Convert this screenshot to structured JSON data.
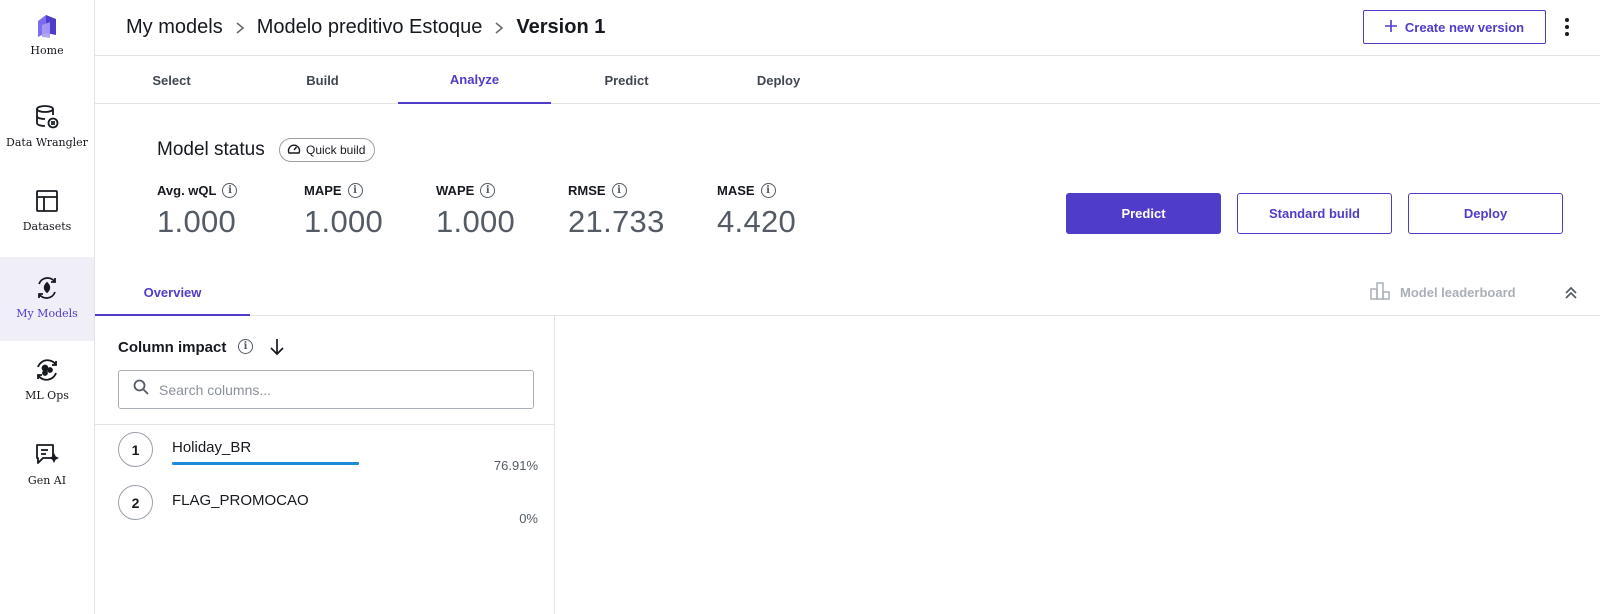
{
  "sidebar": {
    "items": [
      {
        "label": "Home",
        "icon": "canvas-logo-icon"
      },
      {
        "label": "Data Wrangler",
        "icon": "database-icon"
      },
      {
        "label": "Datasets",
        "icon": "table-icon"
      },
      {
        "label": "My Models",
        "icon": "models-icon",
        "active": true
      },
      {
        "label": "ML Ops",
        "icon": "mlops-icon"
      },
      {
        "label": "Gen AI",
        "icon": "chat-sparkle-icon"
      }
    ]
  },
  "header": {
    "breadcrumb": [
      "My models",
      "Modelo preditivo Estoque",
      "Version 1"
    ],
    "create_version_label": "Create new version"
  },
  "tabs": [
    {
      "label": "Select"
    },
    {
      "label": "Build"
    },
    {
      "label": "Analyze",
      "active": true
    },
    {
      "label": "Predict"
    },
    {
      "label": "Deploy"
    }
  ],
  "model_status": {
    "title": "Model status",
    "badge": "Quick build",
    "metrics": [
      {
        "label": "Avg. wQL",
        "value": "1.000"
      },
      {
        "label": "MAPE",
        "value": "1.000"
      },
      {
        "label": "WAPE",
        "value": "1.000"
      },
      {
        "label": "RMSE",
        "value": "21.733"
      },
      {
        "label": "MASE",
        "value": "4.420"
      }
    ],
    "actions": {
      "predict": "Predict",
      "standard_build": "Standard build",
      "deploy": "Deploy"
    }
  },
  "overview": {
    "tab_label": "Overview",
    "leaderboard_label": "Model leaderboard"
  },
  "column_impact": {
    "title": "Column impact",
    "search_placeholder": "Search columns...",
    "rows": [
      {
        "rank": "1",
        "name": "Holiday_BR",
        "percent": "76.91%",
        "fraction": 0.7691
      },
      {
        "rank": "2",
        "name": "FLAG_PROMOCAO",
        "percent": "0%",
        "fraction": 0
      }
    ]
  },
  "colors": {
    "accent": "#4f3cc9",
    "impact_bar": "#1f8ad8"
  }
}
